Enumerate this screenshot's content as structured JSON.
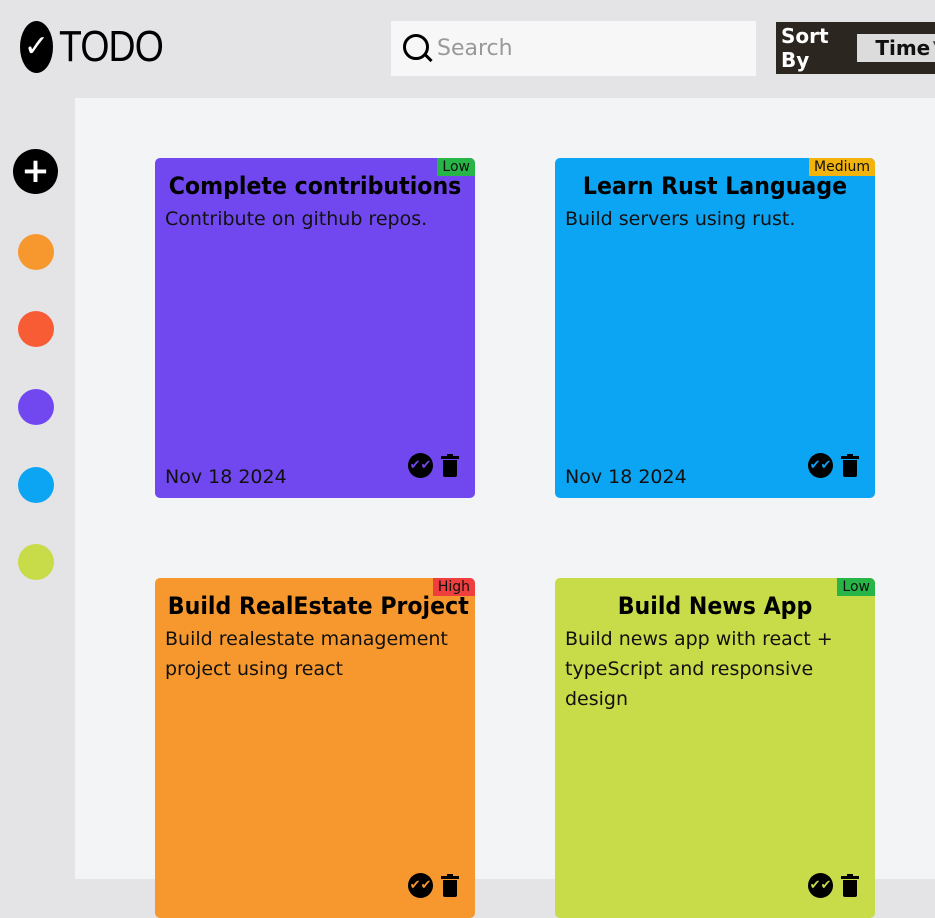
{
  "app": {
    "logo_glyph": "✓",
    "title": "TODO"
  },
  "search": {
    "placeholder": "Search",
    "value": ""
  },
  "sort": {
    "label": "Sort By",
    "selected": "Time"
  },
  "sidebar": {
    "add_glyph": "+",
    "colors": [
      "#f7982e",
      "#f75c35",
      "#7148f0",
      "#0ca5f3",
      "#c8db48"
    ]
  },
  "todos": [
    {
      "title": "Complete contributions",
      "description": "Contribute on github repos.",
      "date": "Nov 18 2024",
      "priority": "Low",
      "priority_color": "#27b548",
      "color": "#7148f0"
    },
    {
      "title": "Learn Rust Language",
      "description": "Build servers using rust.",
      "date": "Nov 18 2024",
      "priority": "Medium",
      "priority_color": "#f2b40c",
      "color": "#0ca5f3"
    },
    {
      "title": "Build RealEstate Project",
      "description": "Build realestate management\nproject using react",
      "date": "",
      "priority": "High",
      "priority_color": "#ee3e3e",
      "color": "#f7982e"
    },
    {
      "title": "Build News App",
      "description": "Build news app with react +\ntypeScript and responsive design",
      "date": "",
      "priority": "Low",
      "priority_color": "#27b548",
      "color": "#c8db48"
    }
  ],
  "icons": {
    "check": "✔✔"
  }
}
